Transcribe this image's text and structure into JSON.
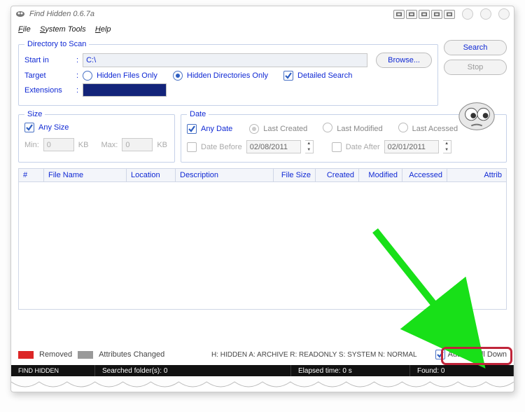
{
  "title": "Find Hidden 0.6.7a",
  "menu": {
    "file": "File",
    "system": "System Tools",
    "help": "Help"
  },
  "dir": {
    "legend": "Directory to Scan",
    "start_label": "Start in",
    "start_value": "C:\\",
    "browse": "Browse...",
    "target_label": "Target",
    "opt_hidden_files": "Hidden Files Only",
    "opt_hidden_dirs": "Hidden Directories Only",
    "opt_detailed": "Detailed Search",
    "ext_label": "Extensions"
  },
  "buttons": {
    "search": "Search",
    "stop": "Stop"
  },
  "size": {
    "legend": "Size",
    "any": "Any Size",
    "min": "Min:",
    "min_val": "0",
    "kb": "KB",
    "max": "Max:",
    "max_val": "0"
  },
  "date": {
    "legend": "Date",
    "any": "Any Date",
    "last_created": "Last Created",
    "last_modified": "Last Modified",
    "last_accessed": "Last Acessed",
    "before": "Date Before",
    "before_val": "02/08/2011",
    "after": "Date After",
    "after_val": "02/01/2011"
  },
  "cols": {
    "num": "#",
    "name": "File Name",
    "loc": "Location",
    "desc": "Description",
    "size": "File Size",
    "created": "Created",
    "modified": "Modified",
    "accessed": "Accessed",
    "attrib": "Attrib"
  },
  "legendbar": {
    "removed": "Removed",
    "attrchg": "Attributes Changed",
    "codes": "H: HIDDEN  A: ARCHIVE  R: READONLY  S: SYSTEM  N: NORMAL",
    "autoscroll": "Auto Scroll Down"
  },
  "status": {
    "app": "FIND HIDDEN",
    "searched": "Searched folder(s): 0",
    "elapsed": "Elapsed time: 0 s",
    "found": "Found: 0"
  }
}
